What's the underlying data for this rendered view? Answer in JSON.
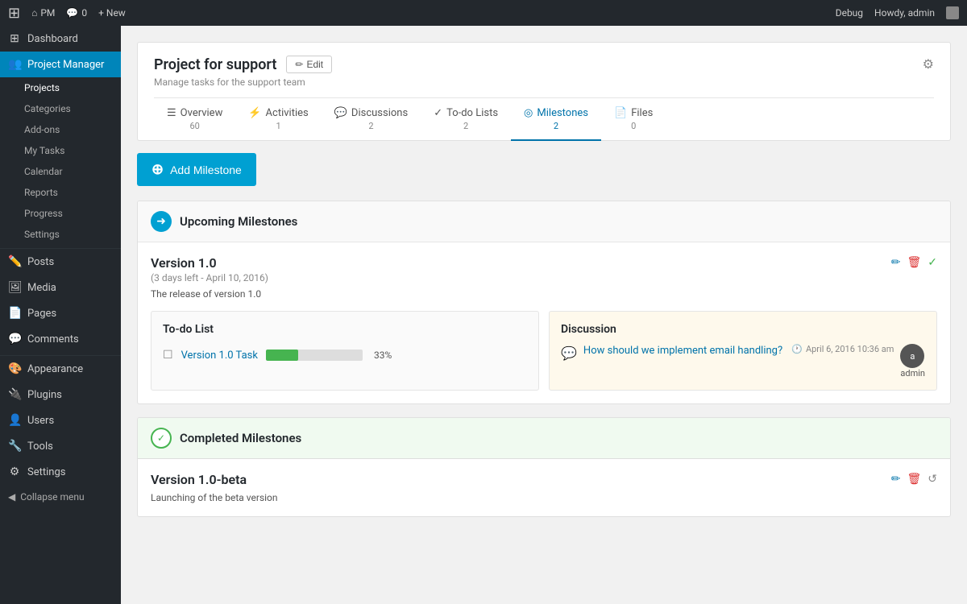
{
  "topbar": {
    "wp_logo": "⊞",
    "pm_label": "PM",
    "comments_count": "0",
    "new_label": "+ New",
    "debug_label": "Debug",
    "howdy_label": "Howdy, admin"
  },
  "sidebar": {
    "dashboard_label": "Dashboard",
    "project_manager_label": "Project Manager",
    "projects_label": "Projects",
    "categories_label": "Categories",
    "addons_label": "Add-ons",
    "my_tasks_label": "My Tasks",
    "calendar_label": "Calendar",
    "reports_label": "Reports",
    "progress_label": "Progress",
    "settings_label": "Settings",
    "posts_label": "Posts",
    "media_label": "Media",
    "pages_label": "Pages",
    "comments_label": "Comments",
    "appearance_label": "Appearance",
    "plugins_label": "Plugins",
    "users_label": "Users",
    "tools_label": "Tools",
    "settings2_label": "Settings",
    "collapse_label": "Collapse menu"
  },
  "project": {
    "title": "Project for support",
    "subtitle": "Manage tasks for the support team",
    "edit_label": "Edit",
    "tabs": [
      {
        "icon": "☰",
        "label": "Overview",
        "count": "60"
      },
      {
        "icon": "⚡",
        "label": "Activities",
        "count": "1"
      },
      {
        "icon": "💬",
        "label": "Discussions",
        "count": "2"
      },
      {
        "icon": "✓",
        "label": "To-do Lists",
        "count": "2"
      },
      {
        "icon": "◎",
        "label": "Milestones",
        "count": "2"
      },
      {
        "icon": "📄",
        "label": "Files",
        "count": "0"
      }
    ],
    "active_tab": 4
  },
  "add_milestone_btn": "Add Milestone",
  "upcoming": {
    "section_title": "Upcoming Milestones",
    "milestone_name": "Version 1.0",
    "milestone_date": "(3 days left - April 10, 2016)",
    "milestone_desc": "The release of version 1.0",
    "todo_box_title": "To-do List",
    "todo_item_link": "Version 1.0 Task",
    "todo_progress": 33,
    "todo_progress_label": "33%",
    "discussion_box_title": "Discussion",
    "discussion_link": "How should we implement email handling?",
    "discussion_date": "April 6, 2016 10:36 am",
    "discussion_author": "admin"
  },
  "completed": {
    "section_title": "Completed Milestones",
    "milestone_name": "Version 1.0-beta",
    "milestone_desc": "Launching of the beta version"
  }
}
